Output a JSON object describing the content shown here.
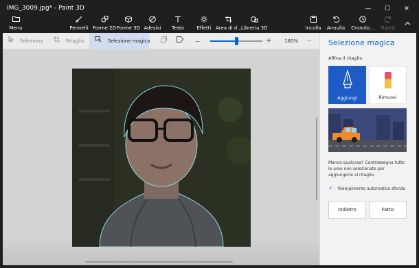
{
  "window": {
    "title": "IMG_3009.jpg* - Paint 3D",
    "minimize_glyph": "—",
    "maximize_glyph": "☐",
    "close_glyph": "✕"
  },
  "menubar": {
    "menu": {
      "label": "Menu",
      "icon": "folder-icon"
    },
    "tools": [
      {
        "label": "Pennelli",
        "icon": "brush-icon"
      },
      {
        "label": "Forme 2D",
        "icon": "shapes-2d-icon"
      },
      {
        "label": "Forme 3D",
        "icon": "cube-icon"
      },
      {
        "label": "Adesivi",
        "icon": "sticker-icon"
      },
      {
        "label": "Testo",
        "icon": "text-icon"
      },
      {
        "label": "Effetti",
        "icon": "effects-icon"
      },
      {
        "label": "Area di d...",
        "icon": "canvas-icon"
      },
      {
        "label": "Libreria 3D",
        "icon": "library-3d-icon"
      }
    ],
    "right": [
      {
        "label": "Incolla",
        "icon": "paste-icon",
        "disabled": false
      },
      {
        "label": "Annulla",
        "icon": "undo-icon",
        "disabled": false
      },
      {
        "label": "Cronolo...",
        "icon": "history-icon",
        "disabled": false
      },
      {
        "label": "Ripeti",
        "icon": "redo-icon",
        "disabled": true
      }
    ]
  },
  "toolbar": {
    "select_label": "Seleziona",
    "crop_label": "Ritaglia",
    "magic_label": "Selezione magica",
    "zoom_minus": "—",
    "zoom_plus": "+",
    "zoom_level": "160%",
    "more": "···",
    "zoom_fraction": 0.5
  },
  "panel": {
    "title": "Selezione magica",
    "subtitle": "Affina il ritaglio",
    "add_label": "Aggiungi",
    "remove_label": "Rimuovi",
    "help_text": "Manca qualcosa? Contrassegna tutte le aree non selezionate per aggiungerle al ritaglio.",
    "checkbox_label": "Riempimento automatico sfondo",
    "checkbox_checked": true,
    "back_label": "Indietro",
    "done_label": "Fatto"
  },
  "colors": {
    "accent": "#0a64c8",
    "add_card": "#1f5bc6",
    "titlebar": "#1f1f1f",
    "canvas_bg": "#d3d3d3"
  }
}
